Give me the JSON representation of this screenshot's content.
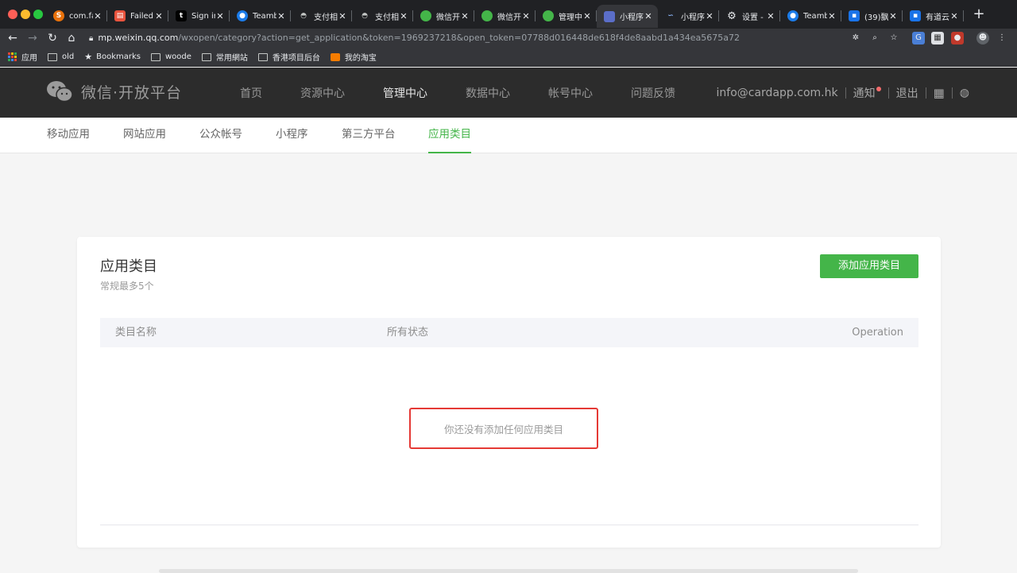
{
  "browser": {
    "tabs": [
      {
        "label": "com.fa",
        "icon": "s-icon",
        "color": "#e8710a",
        "active": false
      },
      {
        "label": "Failed",
        "icon": "mail-icon",
        "color": "#e8533d",
        "active": false
      },
      {
        "label": "Sign in",
        "icon": "t-icon",
        "color": "#202124",
        "active": false
      },
      {
        "label": "Teamb",
        "icon": "teambition-icon",
        "color": "#1b7be8",
        "active": false
      },
      {
        "label": "支付相",
        "icon": "eye-icon",
        "color": "#5f6368",
        "active": false
      },
      {
        "label": "支付相",
        "icon": "eye-icon",
        "color": "#5f6368",
        "active": false
      },
      {
        "label": "微信开",
        "icon": "wechat-icon",
        "color": "#44b549",
        "active": false
      },
      {
        "label": "微信开",
        "icon": "wechat-icon",
        "color": "#44b549",
        "active": false
      },
      {
        "label": "管理中",
        "icon": "wechat-icon",
        "color": "#44b549",
        "active": false
      },
      {
        "label": "小程序",
        "icon": "blank-page-icon",
        "color": "#35363a",
        "active": true
      },
      {
        "label": "小程序",
        "icon": "link-icon",
        "color": "#202124",
        "active": false
      },
      {
        "label": "设置 -",
        "icon": "gear-icon",
        "color": "#202124",
        "active": false
      },
      {
        "label": "Teamb",
        "icon": "teambition-icon",
        "color": "#1b7be8",
        "active": false
      },
      {
        "label": "(39)飘",
        "icon": "doc-icon",
        "color": "#1a73e8",
        "active": false
      },
      {
        "label": "有道云",
        "icon": "doc-icon",
        "color": "#1a73e8",
        "active": false
      }
    ],
    "close_glyph": "✕",
    "new_tab": "+",
    "url_host": "mp.weixin.qq.com",
    "url_path": "/wxopen/category?action=get_application&token=1969237218&open_token=07788d016448de618f4de8aabd1a434ea5675a72",
    "bookmarks": [
      {
        "label": "应用",
        "icon": "apps-icon"
      },
      {
        "label": "old",
        "icon": "folder-icon"
      },
      {
        "label": "Bookmarks",
        "icon": "star-icon"
      },
      {
        "label": "woode",
        "icon": "folder-icon"
      },
      {
        "label": "常用網站",
        "icon": "folder-icon"
      },
      {
        "label": "香港项目后台",
        "icon": "folder-icon"
      },
      {
        "label": "我的淘宝",
        "icon": "taobao-icon"
      }
    ]
  },
  "site": {
    "brand": "微信·开放平台",
    "nav": [
      "首页",
      "资源中心",
      "管理中心",
      "数据中心",
      "帐号中心",
      "问题反馈"
    ],
    "active_nav": 2,
    "account": "info@cardapp.com.hk",
    "notify": "通知",
    "logout": "退出",
    "accent": "#44b549",
    "header_bg": "#2c2c2c"
  },
  "sub_nav": {
    "items": [
      "移动应用",
      "网站应用",
      "公众帐号",
      "小程序",
      "第三方平台",
      "应用类目"
    ],
    "active": 5
  },
  "card": {
    "title": "应用类目",
    "subtitle": "常规最多5个",
    "add_button": "添加应用类目",
    "columns": [
      "类目名称",
      "所有状态",
      "Operation"
    ],
    "empty_text": "你还没有添加任何应用类目",
    "highlight_color": "#e53935"
  }
}
